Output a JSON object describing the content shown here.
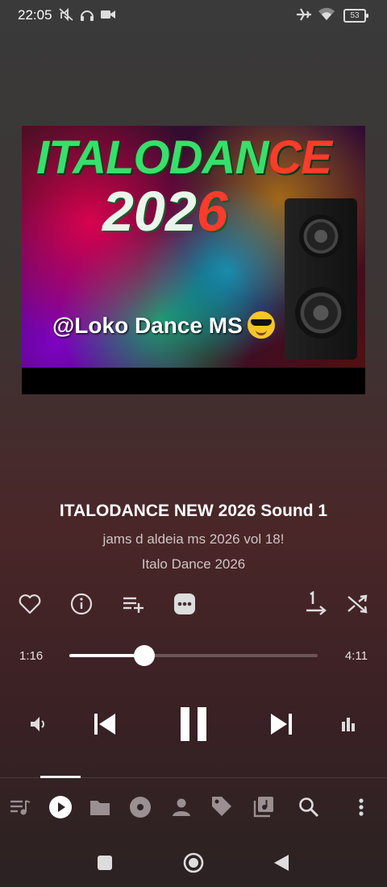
{
  "status_bar": {
    "time": "22:05",
    "battery": "53",
    "left_icons": [
      "mute-off-icon",
      "headphones-icon",
      "video-camera-icon"
    ],
    "right_icons": [
      "airplane-icon",
      "wifi-icon",
      "battery-icon"
    ]
  },
  "album_art": {
    "title_part1": "ITALODAN",
    "title_part2": "CE",
    "year_part1": "202",
    "year_part2": "6",
    "handle": "@Loko Dance MS"
  },
  "song": {
    "title": "ITALODANCE NEW 2026 Sound 1",
    "album": "jams d aldeia ms 2026 vol 18!",
    "artist": "Italo Dance 2026"
  },
  "actions": [
    "heart-icon",
    "info-icon",
    "add-to-playlist-icon",
    "more-icon",
    "repeat-one-icon",
    "shuffle-icon"
  ],
  "playback": {
    "current_time": "1:16",
    "total_time": "4:11",
    "progress": 0.302
  },
  "controls": [
    "volume-icon",
    "previous-icon",
    "pause-icon",
    "next-icon",
    "equalizer-icon"
  ],
  "bottom_nav": {
    "items": [
      "queue-icon",
      "now-playing-icon",
      "folder-icon",
      "album-icon",
      "artist-icon",
      "tag-icon",
      "playlist-icon",
      "search-icon",
      "overflow-icon"
    ],
    "active_index": 1
  },
  "colors": {
    "accent": "#ffffff",
    "art_red": "#ff3b2b",
    "art_green": "#36e06a"
  }
}
